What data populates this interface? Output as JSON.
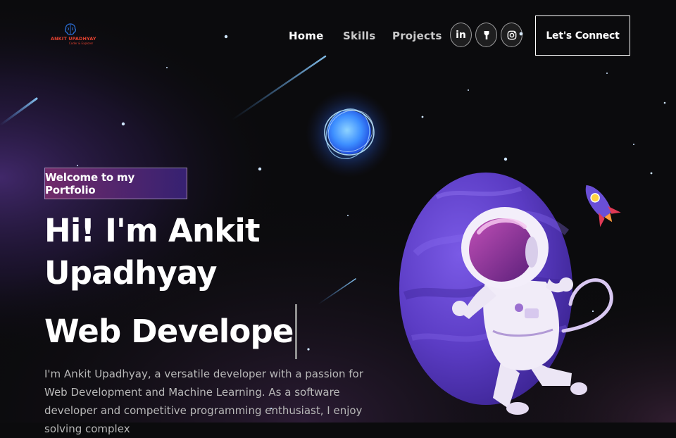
{
  "brand": {
    "name": "ANKIT UPADHYAY",
    "tagline": "Coder & Explorer"
  },
  "nav": {
    "links": [
      {
        "label": "Home",
        "active": true
      },
      {
        "label": "Skills",
        "active": false
      },
      {
        "label": "Projects",
        "active": false
      }
    ],
    "social": [
      {
        "icon": "linkedin-icon",
        "glyph": "in"
      },
      {
        "icon": "github-icon"
      },
      {
        "icon": "instagram-icon"
      }
    ],
    "cta_label": "Let's Connect"
  },
  "hero": {
    "tagline": "Welcome to my Portfolio",
    "greeting": "Hi! I'm Ankit Upadhyay",
    "typed_role": "Web Develope",
    "bio": "I'm Ankit Upadhyay, a versatile developer with a passion for Web Development and Machine Learning. As a software developer and competitive programming enthusiast, I enjoy solving complex"
  },
  "colors": {
    "background": "#0b0b0d",
    "accent_pink": "#aa367c",
    "accent_purple": "#4a2fbd",
    "logo_red": "#e0412f",
    "planet_purple": "#5b3cc4"
  }
}
